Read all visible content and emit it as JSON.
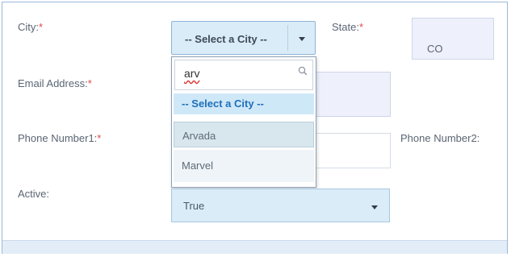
{
  "form": {
    "city": {
      "label": "City:",
      "required_mark": "*",
      "selected": "-- Select a City --"
    },
    "state": {
      "label": "State:",
      "required_mark": "*",
      "value": "CO"
    },
    "email": {
      "label": "Email Address:",
      "required_mark": "*",
      "value": ""
    },
    "phone1": {
      "label": "Phone Number1:",
      "required_mark": "*",
      "value": ""
    },
    "phone2": {
      "label": "Phone Number2:"
    },
    "active": {
      "label": "Active:",
      "selected": "True"
    }
  },
  "city_dropdown": {
    "search_value": "arv",
    "options": [
      "-- Select a City --",
      "Arvada",
      "Marvel"
    ],
    "highlighted": "Arvada"
  },
  "icons": {
    "search": "search-icon",
    "caret": "chevron-down-icon"
  },
  "colors": {
    "required": "#e04848",
    "select_bg": "#d9ecf8",
    "dropdown_header_text": "#1f6fb8",
    "readonly_field_bg": "#eef0fb"
  }
}
